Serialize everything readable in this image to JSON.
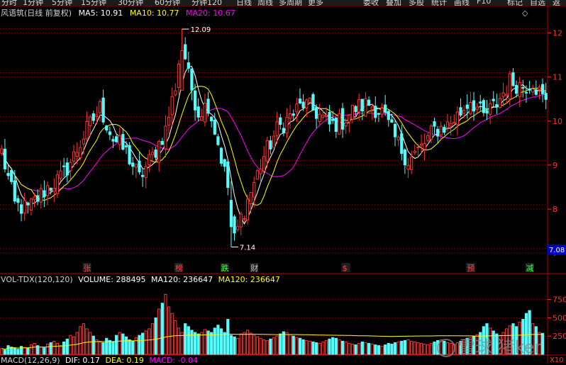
{
  "toolbar": {
    "left_items": [
      "分时",
      "1分钟",
      "5分钟",
      "15分钟",
      "30分钟",
      "60分钟",
      "分钟120",
      "日线",
      "周线",
      "多周期",
      "更多"
    ],
    "right_items": [
      "委收",
      "叠加",
      "多股",
      "统计",
      "画线",
      "F10",
      "标记",
      "自选",
      "返"
    ]
  },
  "chart_header": {
    "name": "风语筑(日线 前复权)",
    "ma5": "MA5: 10.91",
    "ma10": "MA10: 10.77",
    "ma20": "MA20: 10.67",
    "annot_high": "12.09",
    "annot_low": "7.14",
    "last_price_tag": "7.08",
    "diamond": "◇"
  },
  "volume_header": {
    "title": "VOL-TDX(120,120)",
    "volume": "VOLUME: 288495",
    "ma120_white": "MA120: 236647",
    "ma120_yellow": "MA120: 236647",
    "unit": "X10"
  },
  "macd_header": {
    "title": "MACD(12,26,9)",
    "dif": "DIF: 0.17",
    "dea": "DEA: 0.19",
    "macd": "MACD: -0.04"
  },
  "event_markers": [
    {
      "label": "张",
      "index": 26,
      "color": "#ff4040"
    },
    {
      "label": "榜",
      "index": 54,
      "color": "#ff4040"
    },
    {
      "label": "跌",
      "index": 68,
      "color": "#40ff40"
    },
    {
      "label": "财",
      "index": 77,
      "color": "#c0c0c0"
    },
    {
      "label": "$",
      "index": 105,
      "color": "#ff4040"
    },
    {
      "label": "预",
      "index": 143,
      "color": "#ff4040"
    },
    {
      "label": "减",
      "index": 161,
      "color": "#40ff40"
    }
  ],
  "colors": {
    "up": "#ff3232",
    "down": "#54fcfc",
    "ma5": "#ffffff",
    "ma10": "#ffff00",
    "ma20": "#ff00ff",
    "grid": "#8b0000",
    "axis_text": "#ff3232"
  },
  "watermark": "雪球 猪ker",
  "chart_data": [
    {
      "type": "candlestick",
      "title": "风语筑(日线 前复权)",
      "y_ticks": [
        7,
        8,
        9,
        10,
        11,
        12
      ],
      "ylim": [
        6.6,
        12.3
      ],
      "grid": true,
      "series": [
        {
          "name": "MA5",
          "latest": 10.91
        },
        {
          "name": "MA10",
          "latest": 10.77
        },
        {
          "name": "MA20",
          "latest": 10.67
        }
      ],
      "annotations": [
        {
          "text": "12.09",
          "value": 12.09,
          "kind": "high",
          "index": 55
        },
        {
          "text": "7.14",
          "value": 7.14,
          "kind": "low",
          "index": 70
        }
      ],
      "anchors": [
        [
          0,
          9.3
        ],
        [
          4,
          8.1
        ],
        [
          8,
          8.0
        ],
        [
          14,
          8.5
        ],
        [
          18,
          8.7
        ],
        [
          22,
          9.2
        ],
        [
          26,
          9.8
        ],
        [
          30,
          10.3
        ],
        [
          34,
          9.6
        ],
        [
          38,
          9.3
        ],
        [
          42,
          8.7
        ],
        [
          46,
          9.2
        ],
        [
          50,
          9.8
        ],
        [
          53,
          10.8
        ],
        [
          55,
          11.9
        ],
        [
          57,
          11.0
        ],
        [
          60,
          10.2
        ],
        [
          63,
          10.4
        ],
        [
          66,
          9.5
        ],
        [
          69,
          8.5
        ],
        [
          71,
          7.3
        ],
        [
          73,
          7.8
        ],
        [
          76,
          8.4
        ],
        [
          80,
          9.2
        ],
        [
          84,
          9.8
        ],
        [
          88,
          10.1
        ],
        [
          92,
          10.4
        ],
        [
          96,
          10.2
        ],
        [
          100,
          9.9
        ],
        [
          104,
          10.0
        ],
        [
          108,
          10.3
        ],
        [
          112,
          10.4
        ],
        [
          116,
          10.2
        ],
        [
          120,
          9.6
        ],
        [
          124,
          9.1
        ],
        [
          128,
          9.4
        ],
        [
          132,
          9.8
        ],
        [
          136,
          9.9
        ],
        [
          140,
          10.2
        ],
        [
          143,
          10.5
        ],
        [
          147,
          10.1
        ],
        [
          151,
          10.4
        ],
        [
          155,
          10.9
        ],
        [
          159,
          10.8
        ],
        [
          162,
          10.9
        ],
        [
          166,
          10.4
        ]
      ]
    },
    {
      "type": "bar",
      "title": "VOL-TDX(120,120)",
      "y_ticks": [
        250,
        500,
        750
      ],
      "ylim": [
        0,
        950
      ],
      "unit": "X10",
      "values": [
        80,
        60,
        120,
        100,
        90,
        70,
        110,
        95,
        85,
        130,
        150,
        120,
        100,
        90,
        140,
        160,
        180,
        150,
        120,
        170,
        210,
        260,
        240,
        300,
        380,
        420,
        350,
        300,
        250,
        200,
        180,
        160,
        220,
        190,
        170,
        260,
        300,
        280,
        240,
        200,
        180,
        230,
        260,
        290,
        320,
        350,
        420,
        500,
        620,
        700,
        820,
        650,
        560,
        460,
        360,
        300,
        420,
        380,
        330,
        300,
        280,
        300,
        340,
        320,
        300,
        360,
        400,
        350,
        300,
        480,
        260,
        240,
        220,
        280,
        300,
        330,
        290,
        260,
        240,
        220,
        200,
        190,
        210,
        230,
        250,
        280,
        310,
        300,
        270,
        250,
        230,
        220,
        200,
        190,
        180,
        170,
        160,
        150,
        170,
        190,
        210,
        230,
        220,
        200,
        180,
        170,
        150,
        140,
        130,
        150,
        170,
        160,
        150,
        140,
        130,
        120,
        110,
        130,
        150,
        140,
        160,
        170,
        180,
        190,
        200,
        180,
        170,
        160,
        150,
        140,
        130,
        150,
        170,
        190,
        200,
        180,
        160,
        150,
        140,
        160,
        180,
        200,
        220,
        230,
        250,
        270,
        300,
        380,
        420,
        360,
        320,
        280,
        260,
        300,
        350,
        390,
        420,
        380,
        440,
        480,
        560,
        600,
        420,
        380,
        300,
        288
      ]
    },
    {
      "type": "macd",
      "title": "MACD(12,26,9)",
      "series": [
        {
          "name": "DIF",
          "latest": 0.17
        },
        {
          "name": "DEA",
          "latest": 0.19
        },
        {
          "name": "MACD",
          "latest": -0.04
        }
      ]
    }
  ]
}
